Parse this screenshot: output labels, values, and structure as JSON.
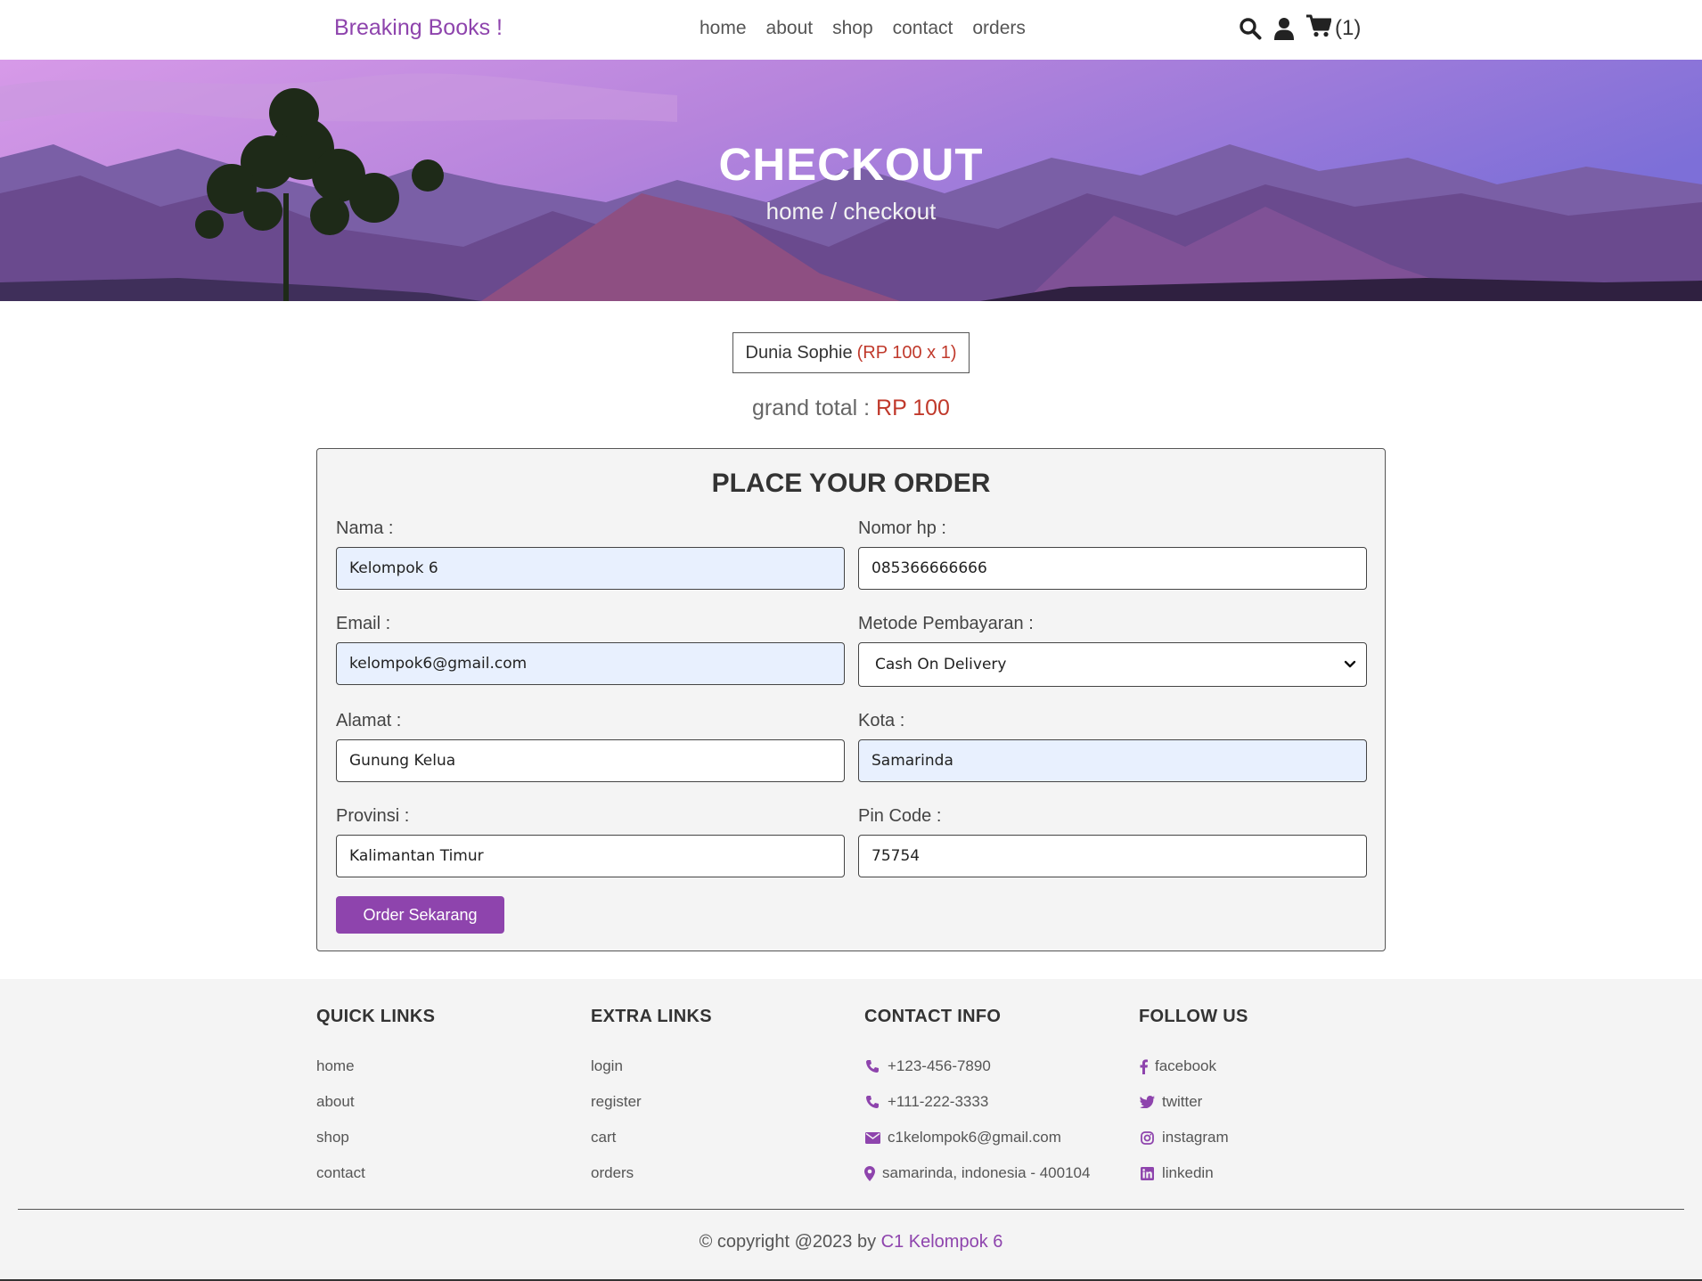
{
  "header": {
    "logo": "Breaking Books !",
    "nav": [
      "home",
      "about",
      "shop",
      "contact",
      "orders"
    ],
    "cart_count": "(1)"
  },
  "hero": {
    "title": "CHECKOUT",
    "breadcrumb": "home / checkout"
  },
  "order": {
    "item_name": "Dunia Sophie",
    "item_price": "(RP 100 x 1)",
    "grand_total_label": "grand total :",
    "grand_total_value": "RP 100"
  },
  "form": {
    "title": "PLACE YOUR ORDER",
    "nama_label": "Nama :",
    "nama_value": "Kelompok 6",
    "nomor_label": "Nomor hp :",
    "nomor_value": "085366666666",
    "email_label": "Email :",
    "email_value": "kelompok6@gmail.com",
    "metode_label": "Metode Pembayaran :",
    "metode_value": "Cash On Delivery",
    "alamat_label": "Alamat :",
    "alamat_value": "Gunung Kelua",
    "kota_label": "Kota :",
    "kota_value": "Samarinda",
    "provinsi_label": "Provinsi :",
    "provinsi_value": "Kalimantan Timur",
    "pin_label": "Pin Code :",
    "pin_value": "75754",
    "submit_label": "Order Sekarang"
  },
  "footer": {
    "quick_links": {
      "title": "QUICK LINKS",
      "items": [
        "home",
        "about",
        "shop",
        "contact"
      ]
    },
    "extra_links": {
      "title": "EXTRA LINKS",
      "items": [
        "login",
        "register",
        "cart",
        "orders"
      ]
    },
    "contact_info": {
      "title": "CONTACT INFO",
      "items": [
        {
          "icon": "phone-icon",
          "text": "+123-456-7890"
        },
        {
          "icon": "phone-icon",
          "text": "+111-222-3333"
        },
        {
          "icon": "envelope-icon",
          "text": "c1kelompok6@gmail.com"
        },
        {
          "icon": "map-marker-icon",
          "text": "samarinda, indonesia - 400104"
        }
      ]
    },
    "follow_us": {
      "title": "FOLLOW US",
      "items": [
        {
          "icon": "facebook-icon",
          "text": "facebook"
        },
        {
          "icon": "twitter-icon",
          "text": "twitter"
        },
        {
          "icon": "instagram-icon",
          "text": "instagram"
        },
        {
          "icon": "linkedin-icon",
          "text": "linkedin"
        }
      ]
    },
    "copyright_prefix": "© copyright @2023 by",
    "copyright_author": "C1 Kelompok 6"
  },
  "colors": {
    "brand": "#8e44ad",
    "price": "#c0392b",
    "autofill": "#e8f0fe",
    "footer_bg": "#f4f4f4"
  }
}
